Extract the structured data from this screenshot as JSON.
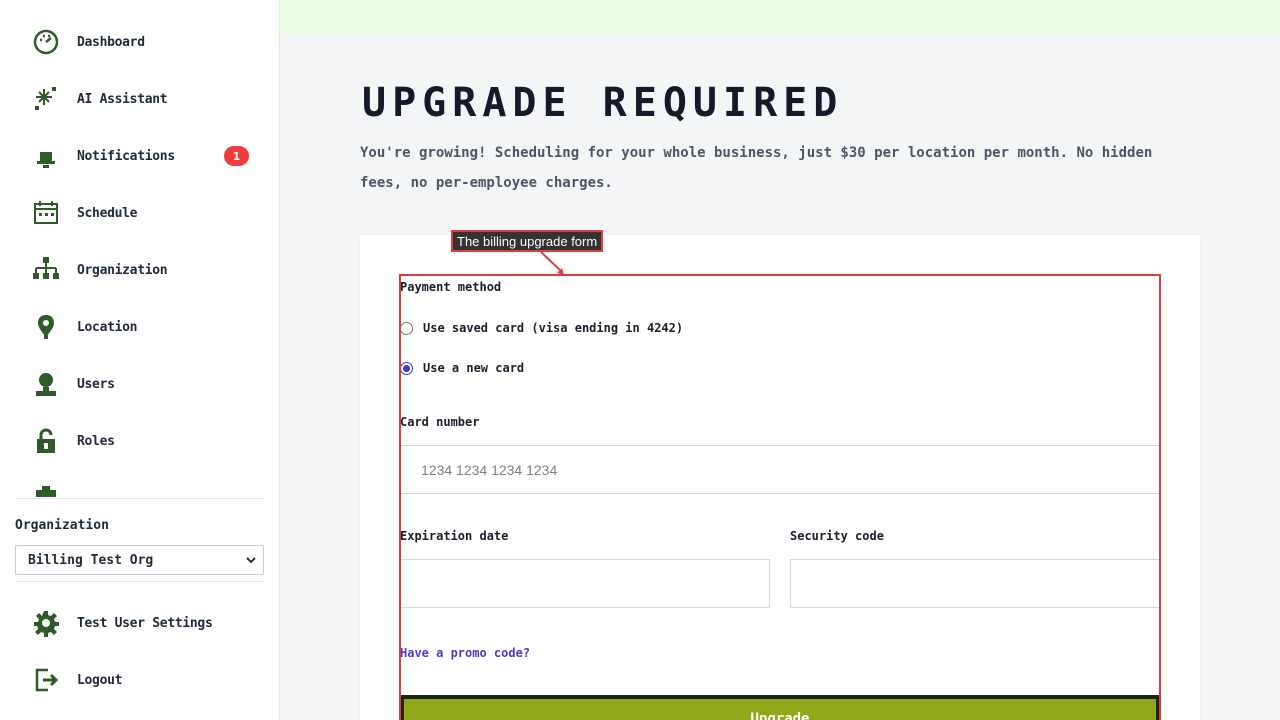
{
  "sidebar": {
    "items": [
      {
        "label": "Dashboard",
        "icon": "dashboard-icon"
      },
      {
        "label": "AI Assistant",
        "icon": "sparkle-icon"
      },
      {
        "label": "Notifications",
        "icon": "bell-icon",
        "badge": "1"
      },
      {
        "label": "Schedule",
        "icon": "calendar-icon"
      },
      {
        "label": "Organization",
        "icon": "org-chart-icon"
      },
      {
        "label": "Location",
        "icon": "map-pin-icon"
      },
      {
        "label": "Users",
        "icon": "user-icon"
      },
      {
        "label": "Roles",
        "icon": "lock-icon"
      }
    ],
    "organization_label": "Organization",
    "organization_value": "Billing Test Org",
    "bottom_items": [
      {
        "label": "Test User Settings",
        "icon": "gear-icon"
      },
      {
        "label": "Logout",
        "icon": "logout-icon"
      }
    ]
  },
  "main": {
    "title": "UPGRADE REQUIRED",
    "subtitle": "You're growing! Scheduling for your whole business, just $30 per location per month. No hidden fees, no per-employee charges."
  },
  "annotation": {
    "label": "The billing upgrade form"
  },
  "form": {
    "payment_method_label": "Payment method",
    "option_saved": "Use saved card (visa ending in 4242)",
    "option_new": "Use a new card",
    "selected_option": "new",
    "card_number_label": "Card number",
    "card_number_placeholder": "1234 1234 1234 1234",
    "expiration_label": "Expiration date",
    "security_label": "Security code",
    "promo_link": "Have a promo code?",
    "submit_label": "Upgrade"
  },
  "colors": {
    "accent": "#91a81b",
    "icon": "#2f5a2a",
    "badge": "#ef3b3b",
    "link": "#4b3ad6",
    "annotation": "#e23b3b",
    "topbar": "#eafde3"
  }
}
